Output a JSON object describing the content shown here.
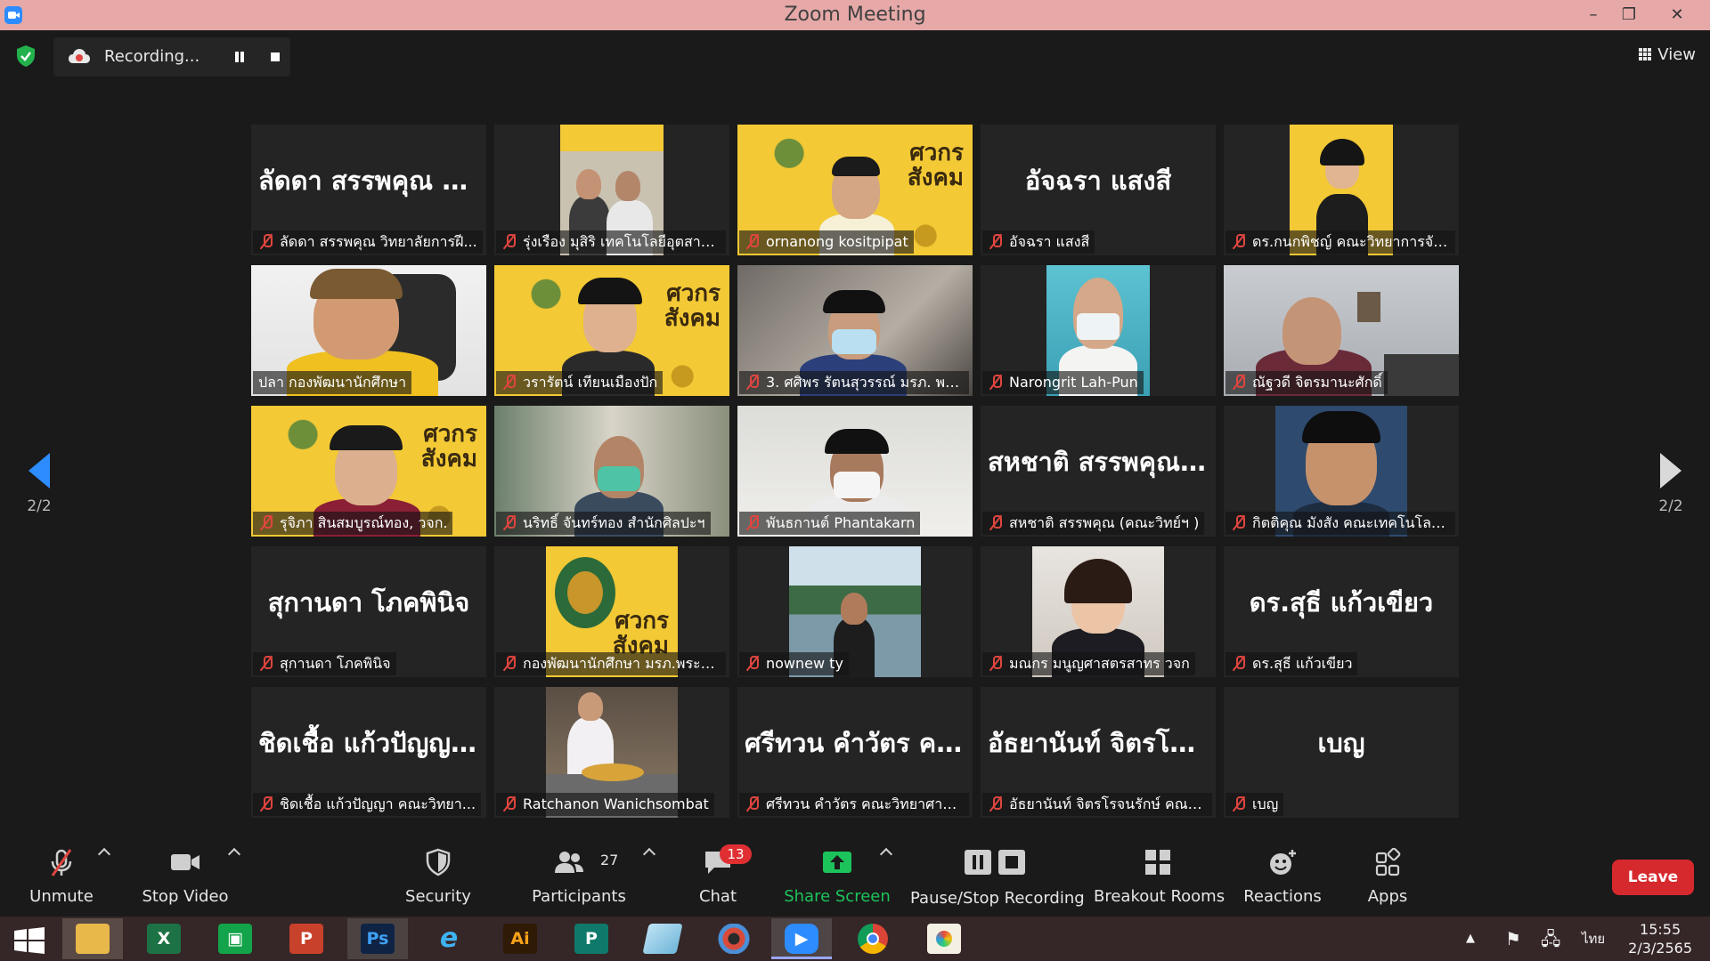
{
  "window": {
    "title": "Zoom Meeting",
    "minimize": "–",
    "restore": "❐",
    "close": "✕"
  },
  "recording": {
    "status": "Recording..."
  },
  "view": {
    "label": "View"
  },
  "pagination": {
    "left_page": "2/2",
    "right_page": "2/2"
  },
  "tiles": [
    {
      "big_name": "ลัดดา สรรพคุณ วิ...",
      "tag": "ลัดดา สรรพคุณ วิทยาลัยการฝี..."
    },
    {
      "big_name": "",
      "tag": "รุ่งเรือง มุสิริ เทคโนโลยีอุตสาหกร..."
    },
    {
      "big_name": "",
      "tag": "ornanong kositpipat"
    },
    {
      "big_name": "อัจฉรา แสงสี",
      "tag": "อัจฉรา แสงสี"
    },
    {
      "big_name": "",
      "tag": "ดร.กนกพิชญ์ คณะวิทยาการจัด..."
    },
    {
      "big_name": "",
      "tag": "ปลา กองพัฒนานักศึกษา"
    },
    {
      "big_name": "",
      "tag": "วรารัตน์ เทียนเมืองปัก"
    },
    {
      "big_name": "",
      "tag": "3. ศศิพร รัตนสุวรรณ์ มรภ. พระ..."
    },
    {
      "big_name": "",
      "tag": "Narongrit Lah-Pun"
    },
    {
      "big_name": "",
      "tag": "ณัฐวดี จิตรมานะศักดิ์"
    },
    {
      "big_name": "",
      "tag": "รุจิภา สินสมบูรณ์ทอง, วจก."
    },
    {
      "big_name": "",
      "tag": "นริทธิ์ จันทร์ทอง สำนักศิลปะฯ"
    },
    {
      "big_name": "",
      "tag": "พันธกานต์ Phantakarn"
    },
    {
      "big_name": "สหชาติ สรรพคุณ...",
      "tag": "สหชาติ สรรพคุณ (คณะวิทย์ฯ )"
    },
    {
      "big_name": "",
      "tag": "กิตติคุณ มังสัง คณะเทคโนโลยีอุ..."
    },
    {
      "big_name": "สุกานดา โภคพินิจ",
      "tag": "สุกานดา โภคพินิจ"
    },
    {
      "big_name": "",
      "tag": "กองพัฒนานักศึกษา มรภ.พระนคร"
    },
    {
      "big_name": "",
      "tag": "nownew ty"
    },
    {
      "big_name": "",
      "tag": "มณกร มนูญศาสตรสาทร วจก"
    },
    {
      "big_name": "ดร.สุธี แก้วเขียว",
      "tag": "ดร.สุธี แก้วเขียว"
    },
    {
      "big_name": "ชิดเชื้อ แก้วปัญญ...",
      "tag": "ชิดเชื้อ แก้วปัญญา คณะวิทยา..."
    },
    {
      "big_name": "",
      "tag": "Ratchanon Wanichsombat"
    },
    {
      "big_name": "ศรีทวน คำวัตร ค...",
      "tag": "ศรีทวน คำวัตร คณะวิทยาศาส..."
    },
    {
      "big_name": "อัธยานันท์ จิตรโร...",
      "tag": "อัธยานันท์ จิตรโรจนรักษ์ คณะเท..."
    },
    {
      "big_name": "เบญ",
      "tag": "เบญ"
    }
  ],
  "slide_text": {
    "line1": "ศวกร",
    "line2": "สังคม"
  },
  "toolbar": {
    "unmute": "Unmute",
    "stop_video": "Stop Video",
    "security": "Security",
    "participants": "Participants",
    "participants_count": "27",
    "chat": "Chat",
    "chat_badge": "13",
    "share_screen": "Share Screen",
    "pause_stop_recording": "Pause/Stop Recording",
    "breakout_rooms": "Breakout Rooms",
    "reactions": "Reactions",
    "apps": "Apps",
    "leave": "Leave"
  },
  "taskbar": {
    "apps": [
      "File Explorer",
      "Excel",
      "Publisher-green",
      "PowerPoint",
      "Photoshop",
      "Internet Explorer",
      "Illustrator",
      "Publisher",
      "Notepad",
      "PhotoScape",
      "Zoom",
      "Chrome",
      "Paint"
    ],
    "language": "ไทย",
    "time": "15:55",
    "date": "2/3/2565"
  },
  "colors": {
    "titlebar": "#e6a9a8",
    "accent_blue": "#2d8cff",
    "active_speaker": "#d5e53a",
    "leave_red": "#d6292d",
    "share_green": "#1cc35b",
    "mute_red": "#e0453f"
  }
}
